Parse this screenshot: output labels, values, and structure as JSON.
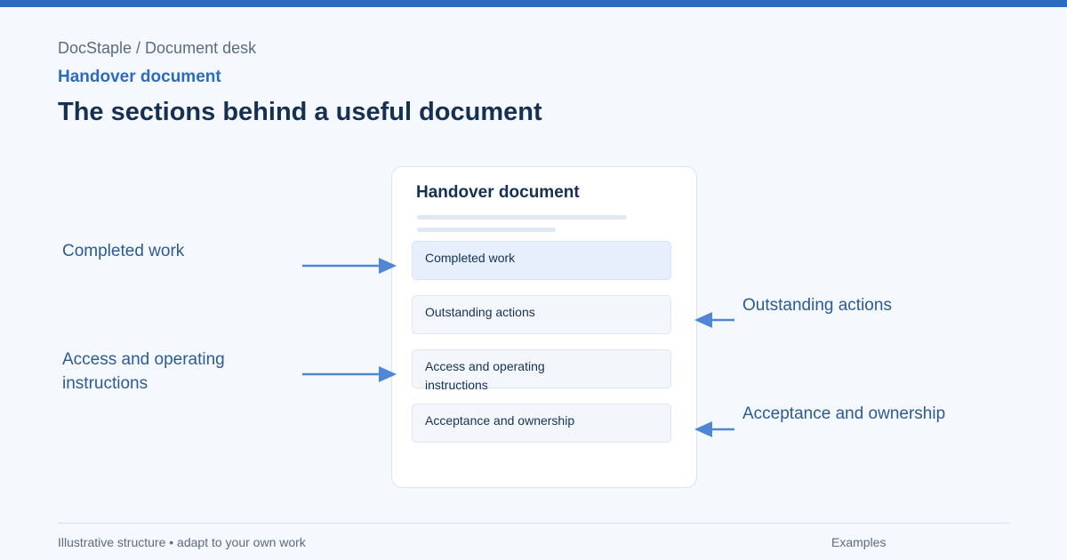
{
  "header": {
    "breadcrumb": "DocStaple / Document desk",
    "eyebrow": "Handover document",
    "title": "The sections behind a useful document"
  },
  "document": {
    "title": "Handover document",
    "sections": [
      "Completed work",
      "Outstanding actions",
      "Access and operating instructions",
      "Acceptance and ownership"
    ]
  },
  "callouts": {
    "completed_work": "Completed work",
    "outstanding_actions": "Outstanding actions",
    "access_instructions": "Access and operating instructions",
    "acceptance_ownership": "Acceptance and ownership"
  },
  "footer": {
    "note": "Illustrative structure • adapt to your own work",
    "link": "Examples"
  },
  "colors": {
    "accent": "#2b6bc0",
    "arrow": "#4f86d6",
    "title": "#163054",
    "background": "#f5f9fd"
  }
}
